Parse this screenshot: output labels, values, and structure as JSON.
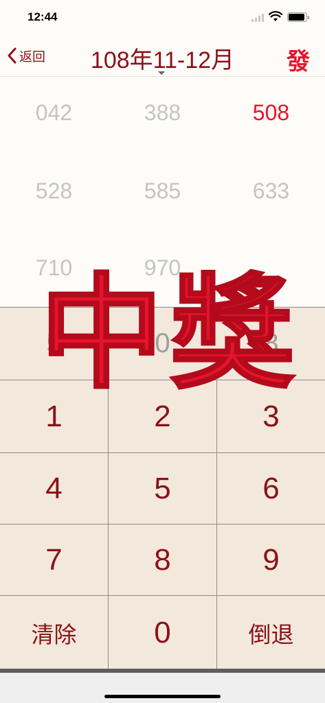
{
  "status_bar": {
    "time": "12:44"
  },
  "nav": {
    "back_label": "返回",
    "title": "108年11-12月",
    "fa_label": "發"
  },
  "winning_numbers": [
    {
      "value": "042",
      "highlighted": false
    },
    {
      "value": "388",
      "highlighted": false
    },
    {
      "value": "508",
      "highlighted": true
    },
    {
      "value": "528",
      "highlighted": false
    },
    {
      "value": "585",
      "highlighted": false
    },
    {
      "value": "633",
      "highlighted": false
    },
    {
      "value": "710",
      "highlighted": false
    },
    {
      "value": "970",
      "highlighted": false
    }
  ],
  "readout": [
    "5",
    "0",
    "8"
  ],
  "keypad": {
    "keys": [
      "1",
      "2",
      "3",
      "4",
      "5",
      "6",
      "7",
      "8",
      "9"
    ],
    "clear_label": "清除",
    "zero_label": "0",
    "backspace_label": "倒退"
  },
  "stamp": {
    "text": "中獎"
  },
  "colors": {
    "accent": "#8b1218",
    "highlight": "#e8132c",
    "keypad_bg": "#f3e8dc",
    "muted": "#c4c4c4"
  }
}
